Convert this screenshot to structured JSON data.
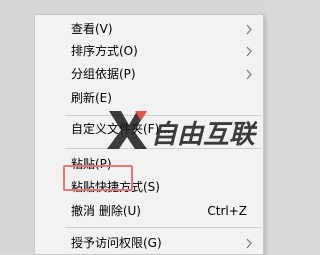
{
  "menu": {
    "items": [
      {
        "label": "查看(V)",
        "has_submenu": true
      },
      {
        "label": "排序方式(O)",
        "has_submenu": true
      },
      {
        "label": "分组依据(P)",
        "has_submenu": true
      },
      {
        "label": "刷新(E)",
        "has_submenu": false
      },
      {
        "label": "自定义文件夹(F)...",
        "has_submenu": false
      },
      {
        "label": "粘贴(P)",
        "has_submenu": false
      },
      {
        "label": "粘贴快捷方式(S)",
        "has_submenu": false
      },
      {
        "label": "撤消 删除(U)",
        "shortcut": "Ctrl+Z",
        "has_submenu": false
      },
      {
        "label": "授予访问权限(G)",
        "has_submenu": true
      }
    ]
  },
  "watermark": {
    "text": "自由互联"
  }
}
